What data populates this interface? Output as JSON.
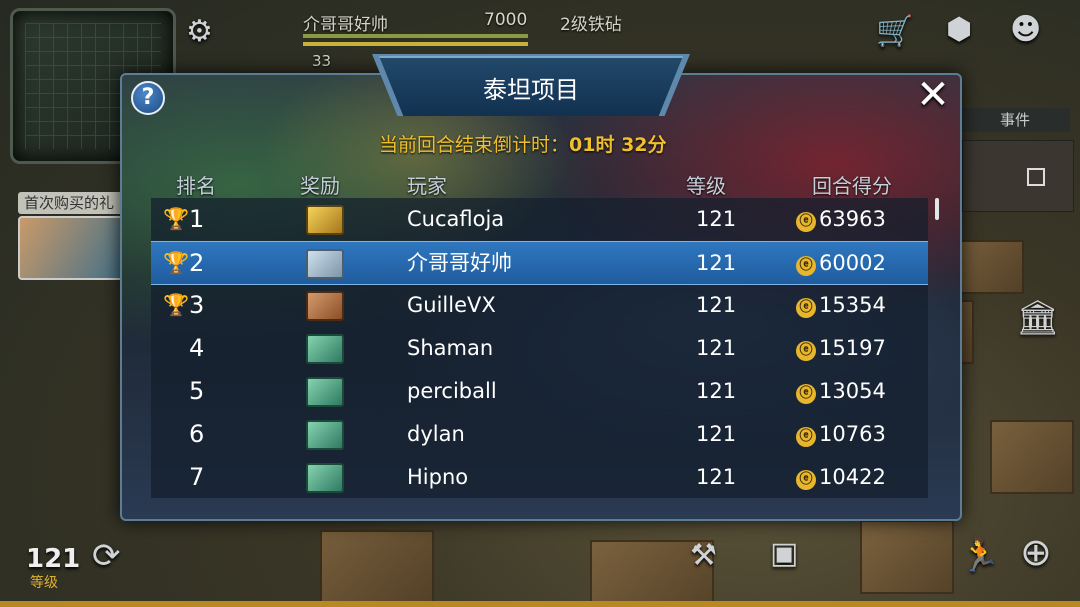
{
  "hud": {
    "player_name": "介哥哥好帅",
    "resource_amount": "7000",
    "resource_label": "2级铁砧",
    "small_count": "33",
    "promo_label": "首次购买的礼",
    "events_tab": "事件",
    "level_value": "121",
    "level_label": "等级"
  },
  "modal": {
    "title": "泰坦项目",
    "help_label": "?",
    "close_label": "✕",
    "countdown_label": "当前回合结束倒计时：",
    "countdown_value": "01时 32分",
    "columns": {
      "rank": "排名",
      "reward": "奖励",
      "player": "玩家",
      "level": "等级",
      "score": "回合得分"
    },
    "rows": [
      {
        "rank": "1",
        "player": "Cucafloja",
        "level": "121",
        "score": "63963"
      },
      {
        "rank": "2",
        "player": "介哥哥好帅",
        "level": "121",
        "score": "60002"
      },
      {
        "rank": "3",
        "player": "GuilleVX",
        "level": "121",
        "score": "15354"
      },
      {
        "rank": "4",
        "player": "Shaman",
        "level": "121",
        "score": "15197"
      },
      {
        "rank": "5",
        "player": "perciball",
        "level": "121",
        "score": "13054"
      },
      {
        "rank": "6",
        "player": "dylan",
        "level": "121",
        "score": "10763"
      },
      {
        "rank": "7",
        "player": "Hipno",
        "level": "121",
        "score": "10422"
      }
    ],
    "selected_row": 2
  },
  "icons": {
    "settings": "gear-icon",
    "shop": "cart-icon",
    "inventory": "box-icon",
    "chat": "robot-icon",
    "trophy": "trophy-icon",
    "coin": "coin-icon",
    "chest": "chest-icon",
    "replay": "replay-icon",
    "anvil": "anvil-icon",
    "backpack": "backpack-icon",
    "run": "run-icon",
    "target": "target-icon",
    "building": "building-icon"
  },
  "colors": {
    "accent_gold": "#f0c02c",
    "selected_row": "#2f77bf",
    "panel_border": "#5d7d95"
  }
}
